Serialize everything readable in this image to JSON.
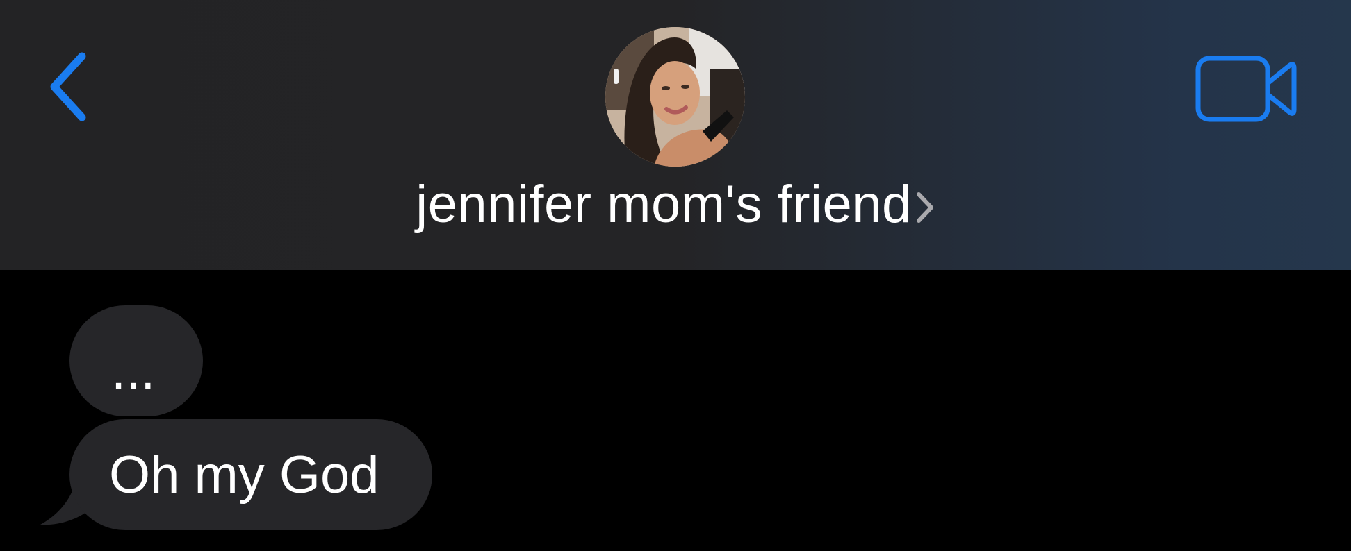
{
  "header": {
    "back_icon": "chevron-left-icon",
    "contact_name": "jennifer mom's friend",
    "contact_chevron_icon": "chevron-right-icon",
    "video_icon": "video-camera-icon",
    "avatar_icon": "contact-photo"
  },
  "messages": [
    {
      "direction": "incoming",
      "text": "..."
    },
    {
      "direction": "incoming",
      "text": "Oh my God"
    }
  ],
  "colors": {
    "accent": "#1A7CF0",
    "incoming_bubble": "#262629",
    "background": "#000000",
    "header_left": "#232325",
    "header_right": "#25374C",
    "text": "#FFFFFF"
  }
}
